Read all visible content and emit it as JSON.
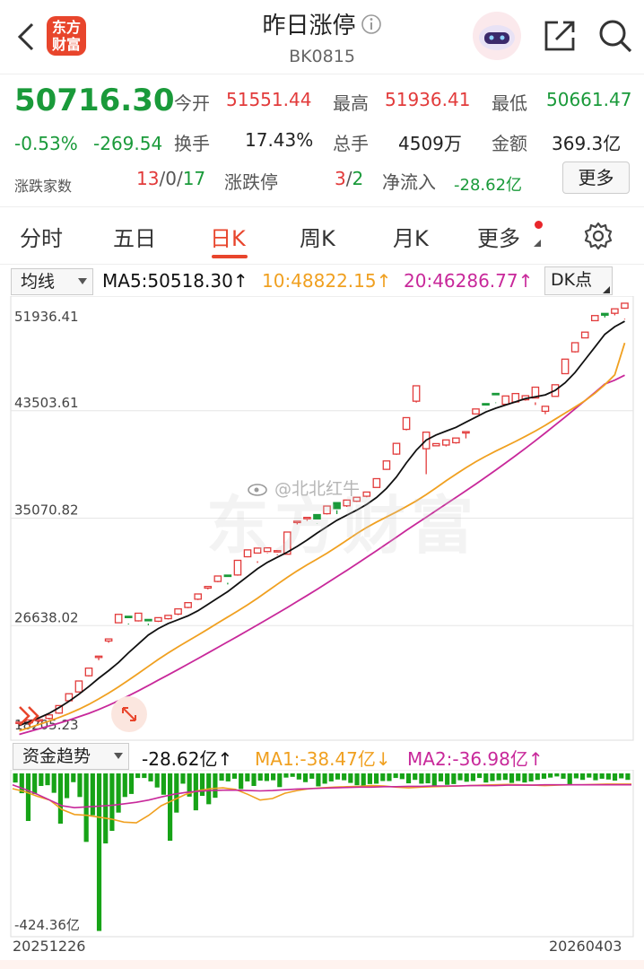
{
  "header": {
    "logo_text": "东方财富",
    "title": "昨日涨停",
    "info_icon": "info-icon",
    "code": "BK0815",
    "back_icon": "back-arrow-icon",
    "share_icon": "share-icon",
    "search_icon": "search-icon",
    "avatar_icon": "robot-avatar-icon"
  },
  "quote": {
    "price": "50716.30",
    "change_pct": "-0.53%",
    "change_amt": "-269.54",
    "open_label": "今开",
    "open": "51551.44",
    "high_label": "最高",
    "high": "51936.41",
    "low_label": "最低",
    "low": "50661.47",
    "turnover_label": "换手",
    "turnover": "17.43%",
    "volume_label": "总手",
    "volume": "4509万",
    "amount_label": "金额",
    "amount": "369.3亿",
    "breadth_label": "涨跌家数",
    "breadth_up": "13",
    "breadth_flat": "0",
    "breadth_down": "17",
    "limit_label": "涨跌停",
    "limit_up": "3",
    "limit_down": "2",
    "netflow_label": "净流入",
    "netflow": "-28.62亿",
    "more_button": "更多"
  },
  "tabs": {
    "items": [
      "分时",
      "五日",
      "日K",
      "周K",
      "月K",
      "更多"
    ],
    "active": "日K",
    "settings_icon": "gear-icon"
  },
  "indicator": {
    "selector": "均线",
    "ma5": "MA5:50518.30",
    "ma10": "10:48822.15",
    "ma20": "20:46286.77",
    "arrow_up": "↑",
    "dk_button": "DK点"
  },
  "flow_indicator": {
    "selector": "资金趋势",
    "value": "-28.62亿",
    "ma1": "MA1:-38.47亿",
    "ma2": "MA2:-36.98亿",
    "arrow_up": "↑",
    "arrow_down": "↓"
  },
  "watermark": "@北北红牛",
  "colors": {
    "up": "#e23b3b",
    "down": "#1a9a3a",
    "ma5": "#111111",
    "ma10": "#f0a020",
    "ma20": "#c8289a",
    "flow_bar": "#17a317",
    "accent": "#e8452c"
  },
  "chart_data": {
    "type": "candlestick",
    "y_ticks": [
      "51936.41",
      "43503.61",
      "35070.82",
      "26638.02",
      "18205.23"
    ],
    "ylim": [
      18205.23,
      51936.41
    ],
    "x_start_label": "20251226",
    "x_end_label": "20260403",
    "candles": [
      [
        18970,
        19060,
        18860,
        18980
      ],
      [
        19010,
        19230,
        18940,
        19130
      ],
      [
        19200,
        19260,
        19030,
        19120
      ],
      [
        19350,
        19630,
        19260,
        19560
      ],
      [
        19770,
        20360,
        19710,
        20270
      ],
      [
        20740,
        21290,
        20740,
        21250
      ],
      [
        21430,
        22290,
        21430,
        22140
      ],
      [
        22700,
        23300,
        22640,
        23220
      ],
      [
        24160,
        24240,
        23920,
        24160
      ],
      [
        25430,
        25590,
        25290,
        25520
      ],
      [
        26860,
        27520,
        26840,
        27250
      ],
      [
        27370,
        27320,
        26730,
        26800
      ],
      [
        27010,
        27610,
        26960,
        27450
      ],
      [
        27120,
        27060,
        26670,
        26790
      ],
      [
        26980,
        27260,
        26920,
        27010
      ],
      [
        27180,
        27440,
        27120,
        27280
      ],
      [
        27540,
        27950,
        27460,
        27840
      ],
      [
        28060,
        28440,
        28000,
        28340
      ],
      [
        28710,
        29120,
        28640,
        28990
      ],
      [
        29580,
        29710,
        29480,
        29630
      ],
      [
        30100,
        30530,
        30040,
        30420
      ],
      [
        30600,
        30530,
        29870,
        30000
      ],
      [
        30610,
        31760,
        30550,
        31640
      ],
      [
        32040,
        32580,
        32000,
        32410
      ],
      [
        32330,
        32720,
        31560,
        31690
      ],
      [
        32450,
        32740,
        32290,
        32330
      ],
      [
        32520,
        32520,
        32160,
        32240
      ],
      [
        32240,
        33980,
        32240,
        33740
      ],
      [
        34740,
        34830,
        34580,
        34720
      ],
      [
        35060,
        35130,
        34860,
        34950
      ],
      [
        35350,
        35010,
        34650,
        34630
      ],
      [
        35420,
        36020,
        35360,
        35940
      ],
      [
        36290,
        35820,
        35690,
        35390
      ],
      [
        36040,
        36490,
        35950,
        36400
      ],
      [
        36400,
        36710,
        36340,
        36510
      ],
      [
        36790,
        37120,
        36710,
        37020
      ],
      [
        37480,
        38170,
        37480,
        38080
      ],
      [
        38900,
        39560,
        38860,
        39390
      ],
      [
        40100,
        40940,
        40040,
        40790
      ],
      [
        42040,
        42960,
        41960,
        42870
      ],
      [
        44250,
        45460,
        44140,
        44640
      ],
      [
        40520,
        41820,
        38520,
        40620
      ],
      [
        40750,
        40920,
        40720,
        40860
      ],
      [
        40810,
        41210,
        40700,
        41070
      ],
      [
        40990,
        41360,
        40920,
        41210
      ],
      [
        41850,
        41860,
        41330,
        41850
      ],
      [
        43250,
        43640,
        43250,
        43580
      ],
      [
        44060,
        44030,
        43620,
        43640
      ],
      [
        44860,
        44850,
        44100,
        44150
      ],
      [
        44010,
        44660,
        43930,
        44550
      ],
      [
        44190,
        44850,
        44130,
        44840
      ],
      [
        44360,
        44680,
        44290,
        44480
      ],
      [
        44500,
        45350,
        43950,
        44160
      ],
      [
        43460,
        43850,
        43230,
        43670
      ],
      [
        44630,
        45540,
        44600,
        45400
      ],
      [
        46410,
        47550,
        46400,
        47250
      ],
      [
        48130,
        48840,
        48070,
        48740
      ],
      [
        49220,
        49670,
        49200,
        49620
      ],
      [
        50570,
        50970,
        50540,
        50720
      ],
      [
        51140,
        51000,
        50820,
        50990
      ],
      [
        51150,
        51500,
        50990,
        51350
      ],
      [
        51550,
        51940,
        50660,
        50720
      ]
    ],
    "ma5": [
      18800,
      19100,
      19400,
      19750,
      20200,
      20700,
      21250,
      21850,
      22500,
      23100,
      23750,
      24500,
      25200,
      25900,
      26400,
      26800,
      27100,
      27400,
      27800,
      28300,
      28800,
      29300,
      29900,
      30500,
      31100,
      31600,
      32000,
      32400,
      32850,
      33350,
      33900,
      34400,
      34900,
      35300,
      35700,
      36150,
      36700,
      37400,
      38300,
      39400,
      40400,
      41200,
      41600,
      41900,
      42200,
      42600,
      43000,
      43400,
      43700,
      43950,
      44200,
      44450,
      44600,
      44750,
      45100,
      45700,
      46500,
      47500,
      48500,
      49500,
      50100,
      50518
    ],
    "ma10": [
      18380,
      18630,
      18880,
      19140,
      19420,
      19730,
      20070,
      20450,
      20880,
      21340,
      21830,
      22350,
      22890,
      23440,
      23980,
      24490,
      24970,
      25430,
      25890,
      26360,
      26840,
      27310,
      27780,
      28270,
      28790,
      29330,
      29880,
      30420,
      30930,
      31410,
      31860,
      32320,
      32820,
      33340,
      33860,
      34340,
      34770,
      35160,
      35560,
      35980,
      36420,
      36920,
      37450,
      38000,
      38520,
      39020,
      39500,
      39930,
      40330,
      40710,
      41090,
      41490,
      41910,
      42360,
      42840,
      43320,
      43790,
      44290,
      44870,
      45540,
      46320,
      48822
    ],
    "ma20": [
      18100,
      18320,
      18540,
      18760,
      18980,
      19220,
      19480,
      19750,
      20050,
      20380,
      20740,
      21120,
      21520,
      21930,
      22350,
      22770,
      23190,
      23620,
      24050,
      24490,
      24920,
      25360,
      25800,
      26240,
      26690,
      27140,
      27600,
      28060,
      28530,
      29000,
      29480,
      29970,
      30470,
      30970,
      31480,
      32000,
      32520,
      33050,
      33580,
      34110,
      34630,
      35140,
      35660,
      36180,
      36700,
      37220,
      37750,
      38290,
      38840,
      39400,
      39970,
      40550,
      41150,
      41760,
      42380,
      43010,
      43650,
      44290,
      44940,
      45600,
      45900,
      46286
    ],
    "flow": {
      "ylim": [
        -424.36,
        0
      ],
      "min_label": "-424.36亿",
      "bars": [
        -24,
        -52,
        -125,
        -54,
        -33,
        -31,
        -51,
        -132,
        -65,
        -23,
        -62,
        -180,
        -110,
        -414,
        -184,
        -151,
        -103,
        -62,
        -54,
        -12,
        -12,
        -21,
        -37,
        -56,
        -177,
        -103,
        -27,
        -61,
        -97,
        -59,
        -81,
        -64,
        -19,
        -21,
        -14,
        -41,
        -21,
        -33,
        -19,
        -20,
        -18,
        -36,
        -11,
        -9,
        -16,
        -23,
        -14,
        -34,
        -27,
        -21,
        -16,
        -18,
        -25,
        -31,
        -36,
        -28,
        -27,
        -20,
        -20,
        -12,
        -15,
        -26,
        -17,
        -27,
        -26,
        -32,
        -21,
        -30,
        -28,
        -18,
        -22,
        -20,
        -12,
        -24,
        -20,
        -18,
        -17,
        -25,
        -20,
        -24,
        -21,
        -17,
        -14,
        -11,
        -8,
        -14,
        -29,
        -13,
        -17,
        -11,
        -18,
        -14,
        -16,
        -19,
        -13,
        -17
      ],
      "ma1": [
        -40,
        -48,
        -60,
        -70,
        -95,
        -108,
        -110,
        -115,
        -120,
        -128,
        -130,
        -110,
        -85,
        -70,
        -55,
        -45,
        -40,
        -38,
        -42,
        -55,
        -70,
        -66,
        -52,
        -45,
        -40,
        -38,
        -36,
        -35,
        -34,
        -32,
        -33,
        -36,
        -38,
        -36,
        -35,
        -34,
        -33,
        -32,
        -31,
        -30,
        -29,
        -30,
        -31,
        -32,
        -31,
        -30,
        -30,
        -29,
        -28,
        -28,
        -28
      ],
      "ma2": [
        -30,
        -42,
        -55,
        -70,
        -85,
        -90,
        -88,
        -86,
        -84,
        -80,
        -76,
        -70,
        -62,
        -55,
        -50,
        -47,
        -45,
        -44,
        -44,
        -45,
        -46,
        -45,
        -43,
        -41,
        -40,
        -39,
        -38,
        -37,
        -36,
        -36,
        -35,
        -35,
        -34,
        -34,
        -33,
        -33,
        -33,
        -32,
        -32,
        -32,
        -31,
        -31,
        -31,
        -30,
        -30,
        -30,
        -30,
        -30,
        -30,
        -30,
        -30
      ]
    }
  }
}
